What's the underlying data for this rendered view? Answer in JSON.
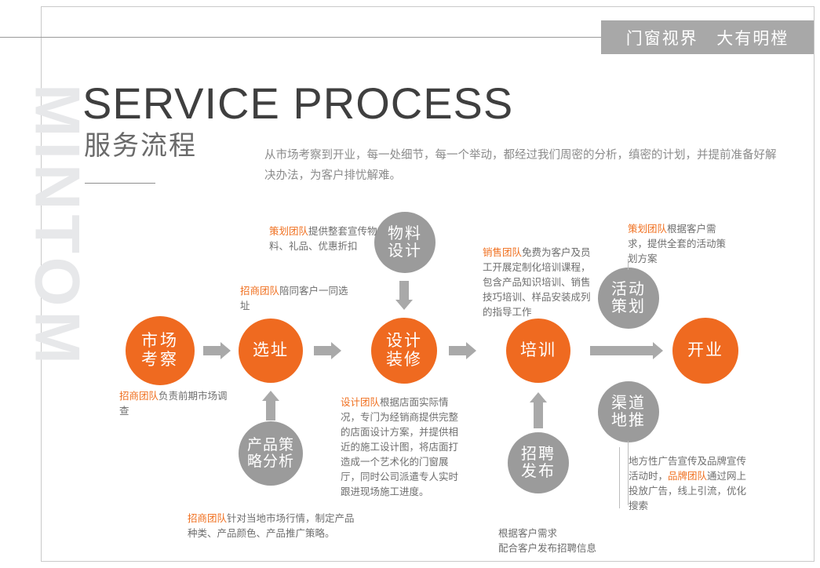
{
  "header": {
    "tag_text": "门窗视界   大有明樘"
  },
  "watermark": "MINTOM",
  "title": {
    "english": "SERVICE PROCESS",
    "chinese": "服务流程"
  },
  "intro": "从市场考察到开业，每一处细节，每一个举动，都经过我们周密的分析，缜密的计划，并提前准备好解决办法，为客户排忧解难。",
  "colors": {
    "orange": "#ef6a20",
    "gray": "#9b9b9b",
    "accent_text": "#f07020",
    "body_text": "#6e6e6e",
    "header_band": "#a8a8a8"
  },
  "nodes": [
    {
      "id": "market-research",
      "label": "市场\n考察",
      "type": "orange"
    },
    {
      "id": "site-selection",
      "label": "选址",
      "type": "orange"
    },
    {
      "id": "design-decoration",
      "label": "设计\n装修",
      "type": "orange"
    },
    {
      "id": "training",
      "label": "培训",
      "type": "orange"
    },
    {
      "id": "opening",
      "label": "开业",
      "type": "orange"
    },
    {
      "id": "material-design",
      "label": "物料\n设计",
      "type": "gray"
    },
    {
      "id": "event-planning",
      "label": "活动\n策划",
      "type": "gray"
    },
    {
      "id": "product-strategy",
      "label": "产品策\n略分析",
      "type": "gray"
    },
    {
      "id": "recruitment",
      "label": "招聘\n发布",
      "type": "gray"
    },
    {
      "id": "channel-promotion",
      "label": "渠道\n地推",
      "type": "gray"
    }
  ],
  "annotations": {
    "material_design": {
      "highlight": "策划团队",
      "text": "提供整套宣传物料、礼品、优惠折扣"
    },
    "site_selection": {
      "highlight": "招商团队",
      "text": "陪同客户一同选址"
    },
    "sales_training": {
      "highlight": "销售团队",
      "text": "免费为客户及员工开展定制化培训课程，包含产品知识培训、销售技巧培训、样品安装成列的指导工作"
    },
    "event_planning": {
      "highlight": "策划团队",
      "text": "根据客户需求，提供全套的活动策划方案"
    },
    "market_research": {
      "highlight": "招商团队",
      "text": "负责前期市场调查"
    },
    "design_team": {
      "highlight": "设计团队",
      "text": "根据店面实际情况，专门为经销商提供完整的店面设计方案，并提供相近的施工设计图，将店面打造成一个艺术化的门窗展厅，同时公司派遣专人实时跟进现场施工进度。"
    },
    "product_strategy": {
      "highlight": "招商团队",
      "text": "针对当地市场行情，制定产品种类、产品颜色、产品推广策略。"
    },
    "recruitment": {
      "highlight": "",
      "text": "根据客户需求\n配合客户发布招聘信息"
    },
    "brand_team": {
      "prefix": "地方性广告宣传及品牌宣传活动时，",
      "highlight": "品牌团队",
      "suffix": "通过网上投放广告，线上引流，优化搜索"
    }
  }
}
